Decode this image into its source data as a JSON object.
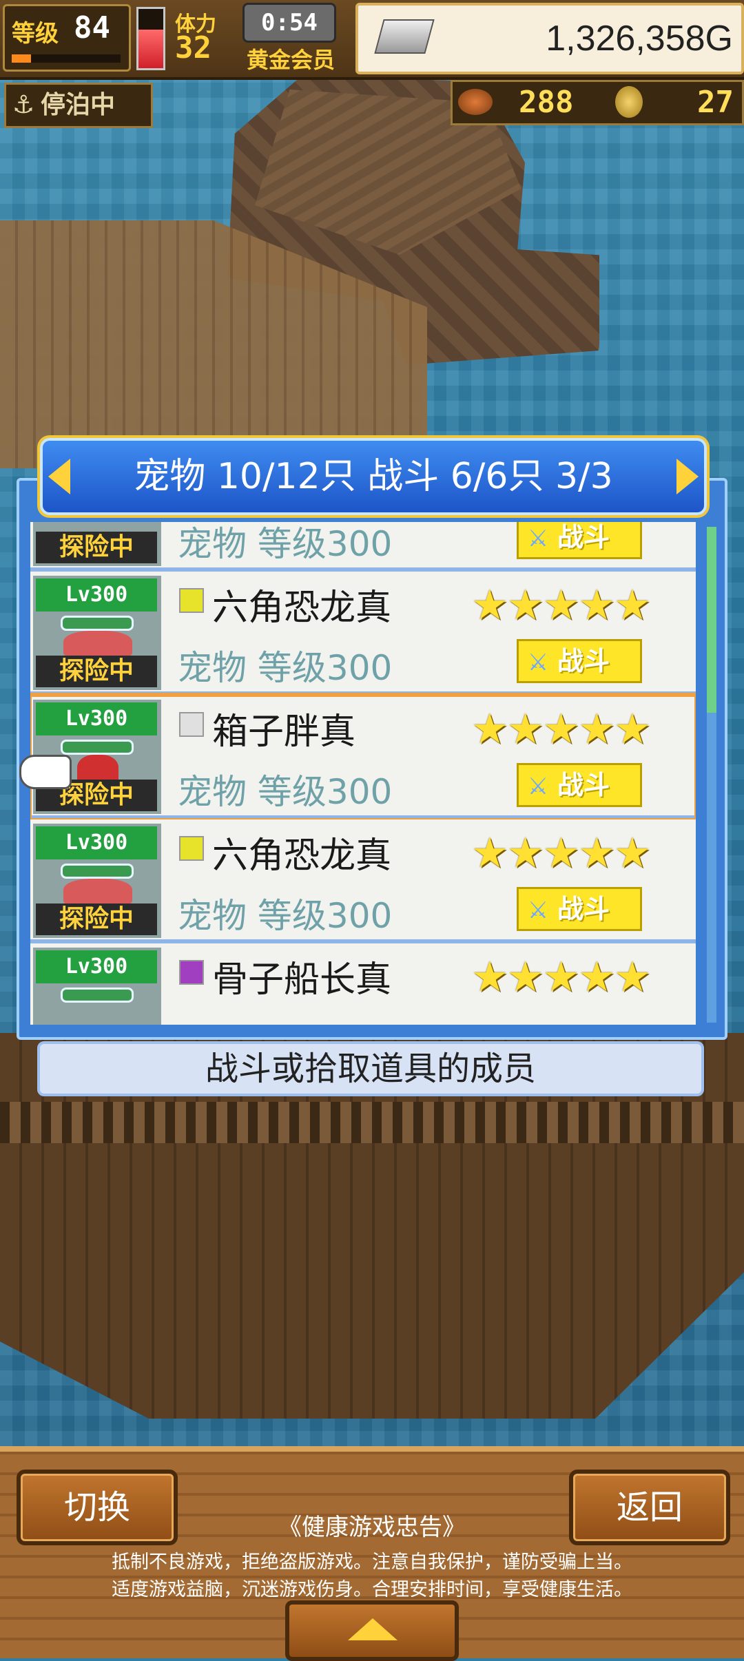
{
  "hud": {
    "level_label": "等级",
    "level": "84",
    "xp_fraction": 0.18,
    "stamina_label": "体力",
    "stamina": "32",
    "stamina_gauge_fraction": 0.65,
    "timer": "0:54",
    "membership": "黄金会员",
    "gold": "1,326,358G",
    "status": "停泊中",
    "food": "288",
    "medals": "27"
  },
  "dialog": {
    "title": "宠物 10/12只 战斗 6/6只  3/3",
    "caption": "战斗或拾取道具的成员",
    "sub_label": "宠物 等级300",
    "fight_label": "战斗",
    "level_tag": "Lv300",
    "explore_label": "探险中",
    "stars": "★★★★★",
    "rows": [
      {
        "name": "",
        "rarity_color": "#e6e32a",
        "creature": "#d04040"
      },
      {
        "name": "六角恐龙真",
        "rarity_color": "#e6e32a",
        "creature": "#d85a5a"
      },
      {
        "name": "箱子胖真",
        "rarity_color": "#e0e0e0",
        "creature": "#d03030"
      },
      {
        "name": "六角恐龙真",
        "rarity_color": "#e6e32a",
        "creature": "#d85a5a"
      },
      {
        "name": "骨子船长真",
        "rarity_color": "#a040c0",
        "creature": "#d0d0d0"
      }
    ]
  },
  "bottom": {
    "switch_label": "切换",
    "back_label": "返回",
    "advisory_title": "《健康游戏忠告》",
    "advisory_line1": "抵制不良游戏，拒绝盗版游戏。注意自我保护，谨防受骗上当。",
    "advisory_line2": "适度游戏益脑，沉迷游戏伤身。合理安排时间，享受健康生活。"
  },
  "colors": {
    "panel_blue": "#3e7fd6",
    "header_blue": "#1d55c8",
    "star_yellow": "#ffe033",
    "fight_yellow": "#ffe528",
    "selected_outline": "#f0a040"
  },
  "icons": {
    "anchor": "anchor-icon",
    "silver_bar": "silver-bar-icon",
    "food": "food-icon",
    "medal": "medal-icon",
    "sword": "sword-icon",
    "pointer": "pointing-hand-icon"
  }
}
